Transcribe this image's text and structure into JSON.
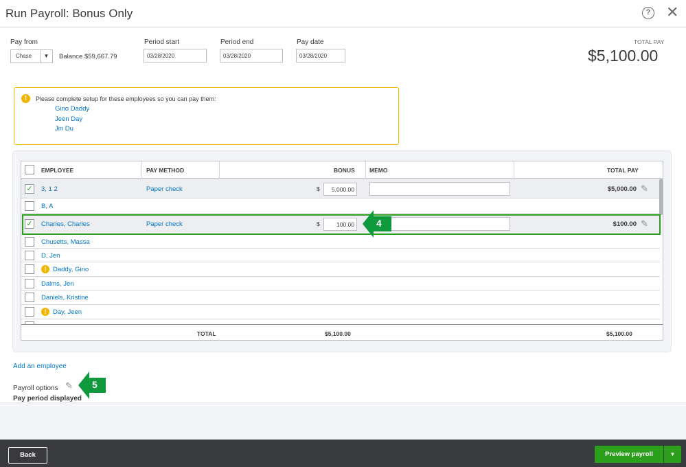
{
  "header": {
    "title": "Run Payroll: Bonus Only",
    "help_glyph": "?",
    "close_glyph": "✕"
  },
  "pay_from": {
    "label": "Pay from",
    "account": "Chase",
    "balance": "Balance $59,667.79"
  },
  "period_start": {
    "label": "Period start",
    "value": "03/28/2020"
  },
  "period_end": {
    "label": "Period end",
    "value": "03/28/2020"
  },
  "pay_date": {
    "label": "Pay date",
    "value": "03/28/2020"
  },
  "total_pay": {
    "label": "TOTAL PAY",
    "amount": "$5,100.00"
  },
  "setup_warning": {
    "message": "Please complete setup for these employees so you can pay them:",
    "employees": [
      "Gino Daddy",
      "Jeen Day",
      "Jin Du"
    ]
  },
  "table": {
    "columns": {
      "employee": "EMPLOYEE",
      "pay_method": "PAY METHOD",
      "bonus": "BONUS",
      "memo": "MEMO",
      "total_pay": "TOTAL PAY"
    },
    "rows": [
      {
        "name": "3, 1 2",
        "checked": true,
        "pay_method": "Paper check",
        "currency": "$",
        "bonus": "5,000.00",
        "total": "$5,000.00"
      },
      {
        "name": "B, A",
        "checked": false
      },
      {
        "name": "Charies, Charies",
        "checked": true,
        "pay_method": "Paper check",
        "currency": "$",
        "bonus": "100.00",
        "total": "$100.00"
      },
      {
        "name": "Chusetts, Massa",
        "checked": false
      },
      {
        "name": "D, Jen",
        "checked": false
      },
      {
        "name": "Daddy, Gino",
        "checked": false,
        "warning": true
      },
      {
        "name": "Dalms, Jen",
        "checked": false
      },
      {
        "name": "Daniels, Kristine",
        "checked": false
      },
      {
        "name": "Day, Jeen",
        "checked": false,
        "warning": true
      }
    ],
    "totals": {
      "label": "TOTAL",
      "bonus": "$5,100.00",
      "total_pay": "$5,100.00"
    }
  },
  "annotations": {
    "step4": "4",
    "step5": "5"
  },
  "links": {
    "add_employee": "Add an employee"
  },
  "payroll_options": {
    "label": "Payroll options",
    "pay_period": "Pay period displayed"
  },
  "footer": {
    "back": "Back",
    "preview": "Preview payroll"
  },
  "colors": {
    "accent_green": "#2ca01c",
    "link_blue": "#0077c5",
    "warning_yellow": "#f1b600",
    "footer_dark": "#393a3d"
  },
  "icons": {
    "warning": "!",
    "check": "✓",
    "pencil": "✎",
    "dropdown": "▼"
  }
}
